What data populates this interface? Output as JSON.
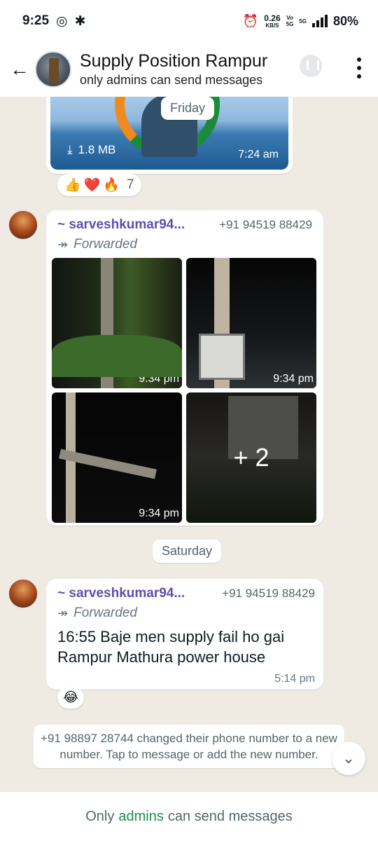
{
  "status_bar": {
    "time": "9:25",
    "speed_value": "0.26",
    "speed_unit": "KB/S",
    "net_top": "Vo",
    "net_bottom": "5G",
    "net_type": "5G",
    "battery": "80%"
  },
  "header": {
    "back_icon": "arrow-left-icon",
    "title": "Supply Position Rampur",
    "subtitle": "only admins can send messages"
  },
  "messages": {
    "first_image": {
      "file_size": "1.8 MB",
      "time": "7:24 am",
      "date_label": "Friday",
      "reactions": [
        "👍",
        "❤️",
        "🔥"
      ],
      "reaction_count": "7"
    },
    "forwarded_images": {
      "sender": "~ sarveshkumar94...",
      "phone": "+91 94519 88429",
      "forwarded_label": "Forwarded",
      "times": [
        "9:34 pm",
        "9:34 pm",
        "9:34 pm"
      ],
      "more_count": "+ 2"
    },
    "date_separator": "Saturday",
    "text_message": {
      "sender": "~ sarveshkumar94...",
      "phone": "+91 94519 88429",
      "forwarded_label": "Forwarded",
      "text_line1": "16:55 Baje men supply fail ho gai",
      "text_line2": "Rampur Mathura power house",
      "time": "5:14 pm",
      "reaction": "😂"
    },
    "system_message": "+91 98897 28744 changed their phone number to a new number. Tap to message or add the new number."
  },
  "footer": {
    "prefix": "Only",
    "link": "admins",
    "suffix": "can send messages"
  }
}
